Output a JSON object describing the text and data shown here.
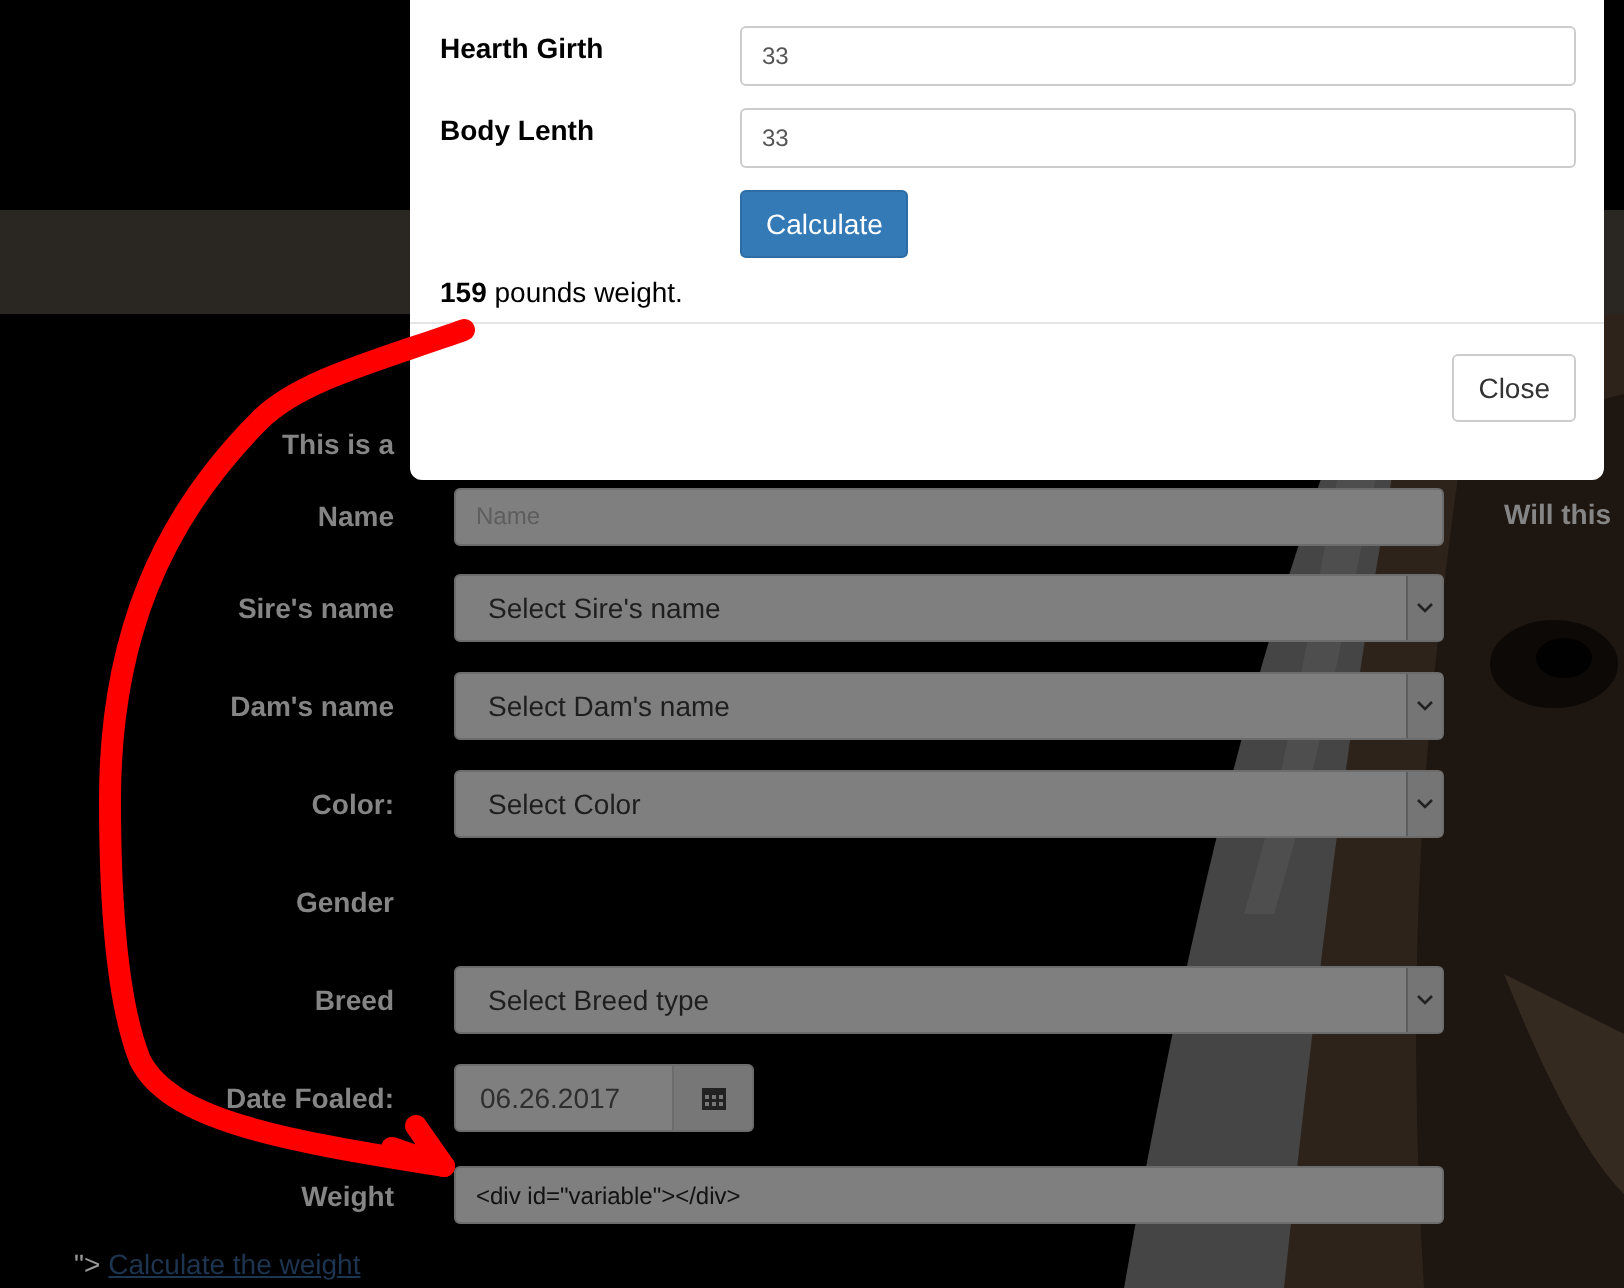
{
  "modal": {
    "fields": [
      {
        "label": "Hearth Girth",
        "value": "33"
      },
      {
        "label": "Body Lenth",
        "value": "33"
      }
    ],
    "calculate_button": "Calculate",
    "result": "**159** pounds weight.",
    "close_button": "Close"
  },
  "form": {
    "intro": "This is a",
    "side_note": "Will this",
    "rows": [
      {
        "kind": "text",
        "label": "Name",
        "placeholder": "Name"
      },
      {
        "kind": "select",
        "label": "Sire's name",
        "value": "Select Sire's name"
      },
      {
        "kind": "select",
        "label": "Dam's name",
        "value": "Select Dam's name"
      },
      {
        "kind": "select",
        "label": "Color:",
        "value": "Select Color"
      },
      {
        "kind": "heading",
        "label": "Gender"
      },
      {
        "kind": "select",
        "label": "Breed",
        "value": "Select Breed type"
      },
      {
        "kind": "date",
        "label": "Date Foaled:",
        "value": "06.26.2017"
      },
      {
        "kind": "text",
        "label": "Weight",
        "value": "<div id=\"variable\"></div>"
      }
    ],
    "link_prefix": "\">",
    "link": "Calculate the weight"
  }
}
